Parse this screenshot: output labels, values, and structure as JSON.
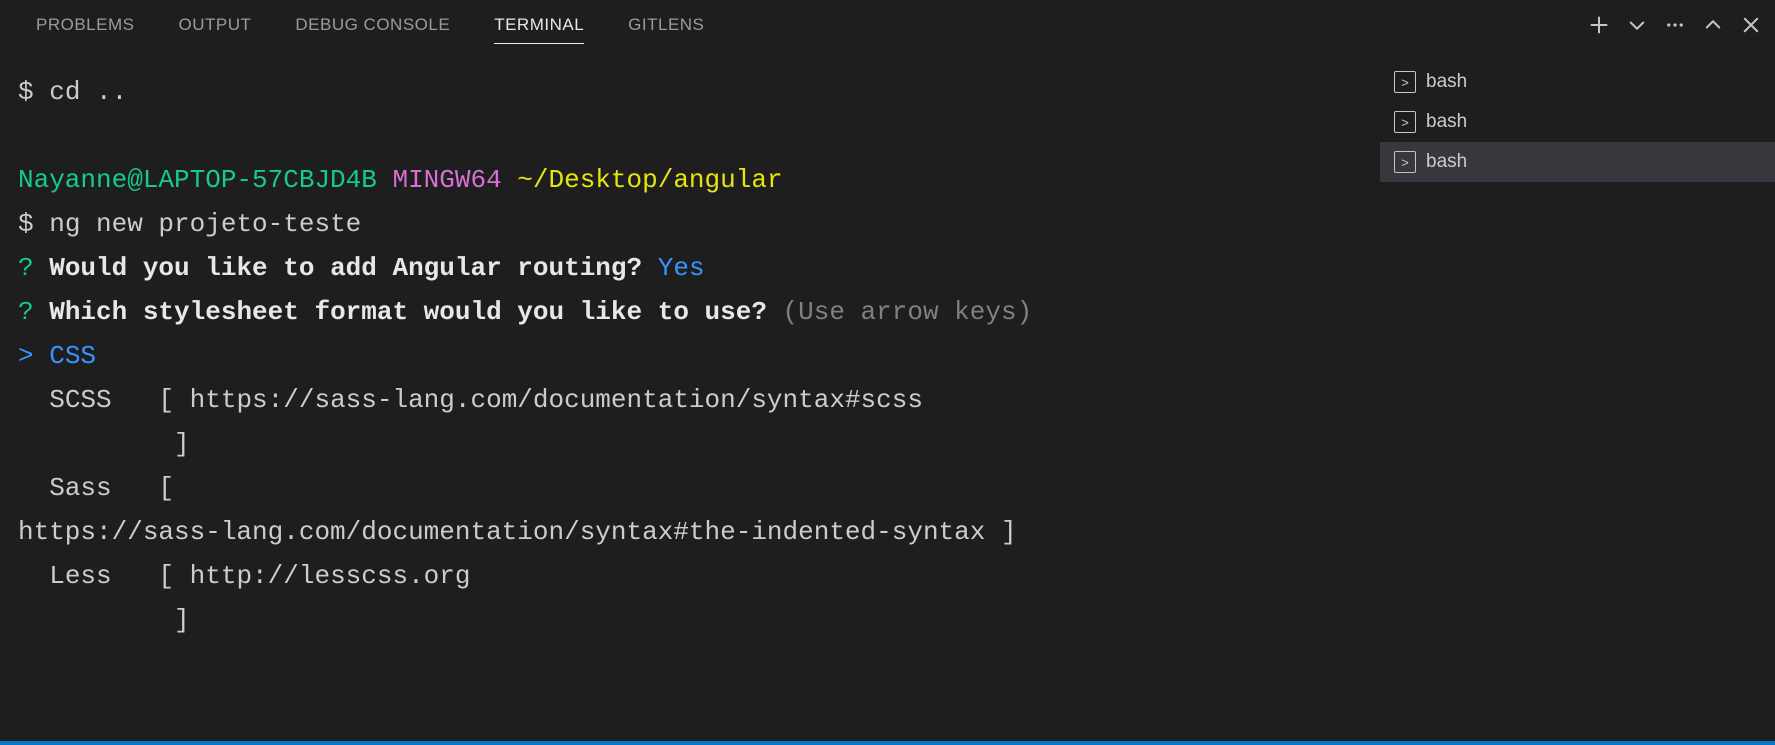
{
  "tabs": {
    "problems": "PROBLEMS",
    "output": "OUTPUT",
    "debug": "DEBUG CONSOLE",
    "terminal": "TERMINAL",
    "gitlens": "GITLENS",
    "active": "terminal"
  },
  "shells": [
    {
      "label": "bash",
      "active": false
    },
    {
      "label": "bash",
      "active": false
    },
    {
      "label": "bash",
      "active": true
    }
  ],
  "term": {
    "prompt_symbol": "$",
    "cmd_cd": "cd ..",
    "user_host": "Nayanne@LAPTOP-57CBJD4B",
    "mingw": "MINGW64",
    "cwd": "~/Desktop/angular",
    "cmd_ng": "ng new projeto-teste",
    "q_mark": "?",
    "q1": "Would you like to add Angular routing?",
    "q1_answer": "Yes",
    "q2": "Which stylesheet format would you like to use?",
    "q2_hint": "(Use arrow keys)",
    "sel_marker": ">",
    "opt_css": "CSS",
    "opt_scss": "SCSS   [ https://sass-lang.com/documentation/syntax#scss",
    "opt_scss2": "          ]",
    "opt_sass": "Sass   [",
    "opt_sass2": "https://sass-lang.com/documentation/syntax#the-indented-syntax ]",
    "opt_less": "Less   [ http://lesscss.org",
    "opt_less2": "          ]"
  }
}
